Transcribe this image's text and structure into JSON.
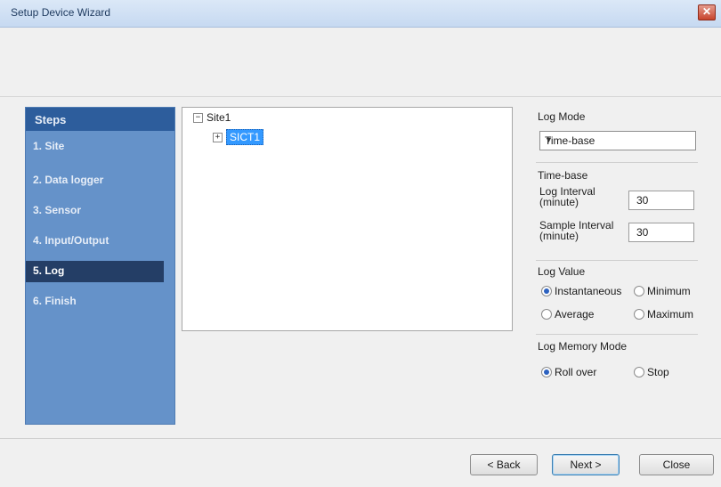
{
  "window": {
    "title": "Setup Device Wizard",
    "close_label": "✕"
  },
  "steps": {
    "header": "Steps",
    "items": [
      {
        "label": "1. Site"
      },
      {
        "label": "2. Data logger"
      },
      {
        "label": "3. Sensor"
      },
      {
        "label": "4. Input/Output"
      },
      {
        "label": "5. Log"
      },
      {
        "label": "6. Finish"
      }
    ],
    "active_index": 4
  },
  "tree": {
    "root": {
      "label": "Site1",
      "expander": "⊟"
    },
    "child": {
      "label": "SICT1",
      "expander": "⊞"
    }
  },
  "log_mode": {
    "label": "Log Mode",
    "selected": "Time-base",
    "options": [
      "Time-base"
    ]
  },
  "time_base": {
    "label": "Time-base",
    "log_interval_label_1": "Log Interval",
    "log_interval_label_2": "(minute)",
    "log_interval_value": "30",
    "sample_interval_label_1": "Sample Interval",
    "sample_interval_label_2": "(minute)",
    "sample_interval_value": "30"
  },
  "log_value": {
    "label": "Log Value",
    "options": [
      "Instantaneous",
      "Minimum",
      "Average",
      "Maximum"
    ],
    "selected": "Instantaneous"
  },
  "log_memory_mode": {
    "label": "Log Memory Mode",
    "options": [
      "Roll over",
      "Stop"
    ],
    "selected": "Roll over"
  },
  "buttons": {
    "back": "< Back",
    "next": "Next >",
    "close": "Close"
  }
}
